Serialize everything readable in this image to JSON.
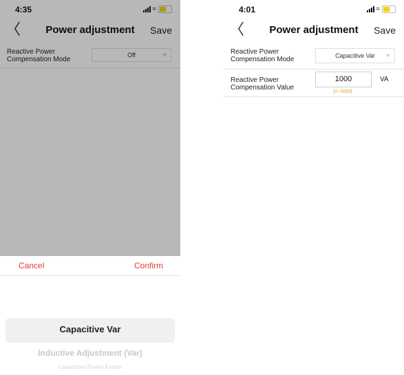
{
  "left": {
    "status": {
      "time": "4:35"
    },
    "nav": {
      "back": "〈",
      "title": "Power adjustment",
      "save": "Save"
    },
    "row1": {
      "label": "Reactive Power\nCompensation Mode",
      "value": "Off"
    },
    "sheet": {
      "cancel": "Cancel",
      "confirm": "Confirm",
      "options": [
        "Capacitive Var",
        "Inductive Adjustment (Var)",
        "Capacitive Power Factor"
      ],
      "selected": "Capacitive Var"
    }
  },
  "right": {
    "status": {
      "time": "4:01"
    },
    "nav": {
      "back": "〈",
      "title": "Power adjustment",
      "save": "Save"
    },
    "row1": {
      "label": "Reactive Power\nCompensation Mode",
      "value": "Capacitive Var"
    },
    "row2": {
      "label": "Reactive Power\nCompensation Value",
      "value": "1000",
      "range": "[0~3000]",
      "unit": "VA"
    }
  },
  "colors": {
    "accent": "#e23b30",
    "hint": "#e9a23b",
    "overlay": "rgba(0,0,0,0.28)"
  },
  "icons": [
    "back-chevron-icon",
    "signal-icon",
    "wifi-icon",
    "battery-charging-icon",
    "dropdown-caret-icon"
  ]
}
